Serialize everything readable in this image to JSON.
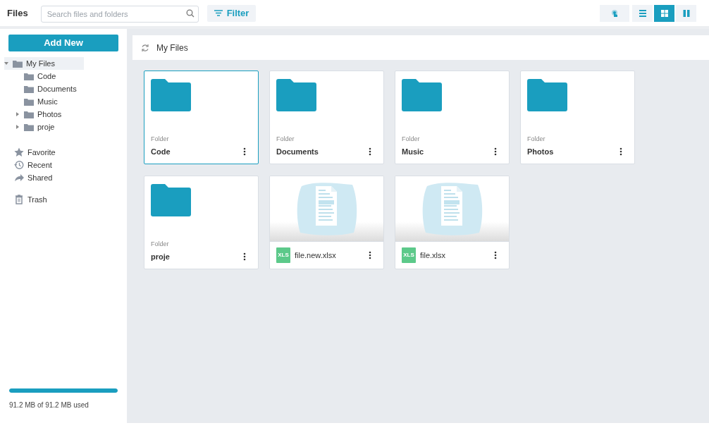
{
  "header": {
    "title": "Files",
    "search": {
      "placeholder": "Search files and folders"
    },
    "filter_button": "Filter",
    "view_buttons": [
      {
        "kind": "touch",
        "selected": false
      },
      {
        "kind": "list",
        "selected": false
      },
      {
        "kind": "grid",
        "selected": true
      },
      {
        "kind": "columns",
        "selected": false
      }
    ]
  },
  "sidebar": {
    "add_button": "Add New",
    "tree": [
      {
        "label": "My Files",
        "expanded": true,
        "selected": true,
        "children": [
          {
            "label": "Code",
            "selected": false
          },
          {
            "label": "Documents",
            "selected": false
          },
          {
            "label": "Music",
            "selected": false
          },
          {
            "label": "Photos",
            "expanded": false,
            "selected": false,
            "has_children": true
          },
          {
            "label": "proje",
            "expanded": false,
            "selected": false,
            "has_children": true
          }
        ]
      }
    ],
    "nav": [
      {
        "kind": "favorite",
        "label": "Favorite"
      },
      {
        "kind": "recent",
        "label": "Recent"
      },
      {
        "kind": "shared",
        "label": "Shared"
      },
      {
        "kind": "trash",
        "label": "Trash"
      }
    ],
    "storage": {
      "level": 1,
      "text": "91.2 MB of 91.2 MB used"
    }
  },
  "breadcrumb": "My Files",
  "items": [
    {
      "kind": "folder",
      "type_label": "Folder",
      "name": "Code",
      "selected": true
    },
    {
      "kind": "folder",
      "type_label": "Folder",
      "name": "Documents",
      "selected": false
    },
    {
      "kind": "folder",
      "type_label": "Folder",
      "name": "Music",
      "selected": false
    },
    {
      "kind": "folder",
      "type_label": "Folder",
      "name": "Photos",
      "selected": false
    },
    {
      "kind": "folder",
      "type_label": "Folder",
      "name": "proje",
      "selected": false
    },
    {
      "kind": "file",
      "badge": "XLS",
      "name": "file.new.xlsx",
      "selected": false
    },
    {
      "kind": "file",
      "badge": "XLS",
      "name": "file.xlsx",
      "selected": false
    }
  ]
}
